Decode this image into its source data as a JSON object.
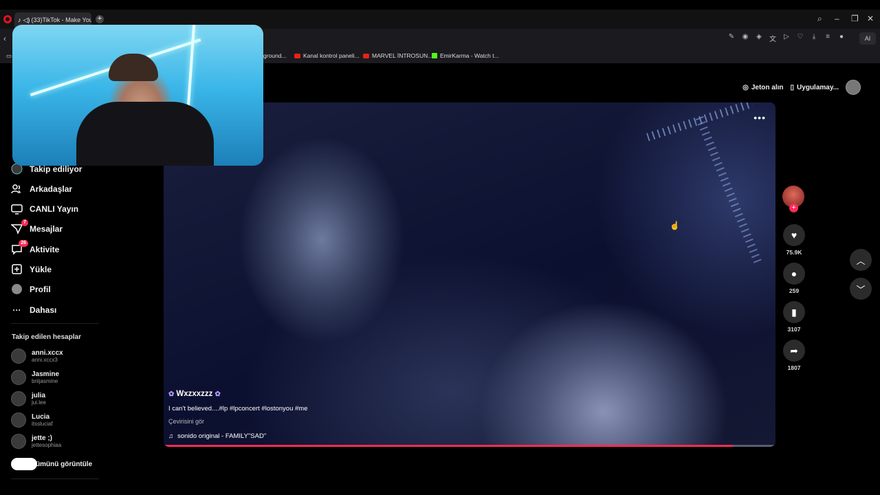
{
  "browser": {
    "tab_title": "(33)TikTok - Make You",
    "bookmarks": [
      {
        "label": "ground...",
        "icon": "folder-icon"
      },
      {
        "label": "Kanal kontrol paneli...",
        "icon": "youtube-icon"
      },
      {
        "label": "MARVEL İNTROSUN...",
        "icon": "youtube-icon"
      },
      {
        "label": "EmirKarma - Watch t...",
        "icon": "kick-icon"
      }
    ],
    "ai_label": "AI"
  },
  "sidebar": {
    "nav": [
      {
        "label": "Takip ediliyor",
        "icon": "following-icon"
      },
      {
        "label": "Arkadaşlar",
        "icon": "friends-icon"
      },
      {
        "label": "CANLI Yayın",
        "icon": "live-icon"
      },
      {
        "label": "Mesajlar",
        "icon": "messages-icon",
        "badge": "7"
      },
      {
        "label": "Aktivite",
        "icon": "activity-icon",
        "badge": "26"
      },
      {
        "label": "Yükle",
        "icon": "upload-icon"
      },
      {
        "label": "Profil",
        "icon": "profile-icon"
      },
      {
        "label": "Dahası",
        "icon": "more-icon"
      }
    ],
    "following_title": "Takip edilen hesaplar",
    "accounts": [
      {
        "name": "anni.xccx",
        "handle": "anni.xccx3"
      },
      {
        "name": "Jasmine",
        "handle": "briijasmine"
      },
      {
        "name": "julia",
        "handle": "jui.lee"
      },
      {
        "name": "Lucia",
        "handle": "itssluciaf"
      },
      {
        "name": "jette ;)",
        "handle": "jettesophiaa"
      }
    ],
    "see_all": "ümünü görüntüle"
  },
  "header": {
    "coins": "Jeton alın",
    "app": "Uygulamay..."
  },
  "video": {
    "author": "Wxzxxzzz",
    "caption": "I can't believed....#lp #lpconcert #lostonyou #me",
    "translate": "Çevirisini gör",
    "sound": "sonido original - FAMILY\"SAD\"",
    "progress": 0.93
  },
  "actions": {
    "likes": "75.9K",
    "comments": "259",
    "saves": "3107",
    "shares": "1807"
  },
  "colors": {
    "accent": "#fe2c55",
    "background": "#000000"
  }
}
